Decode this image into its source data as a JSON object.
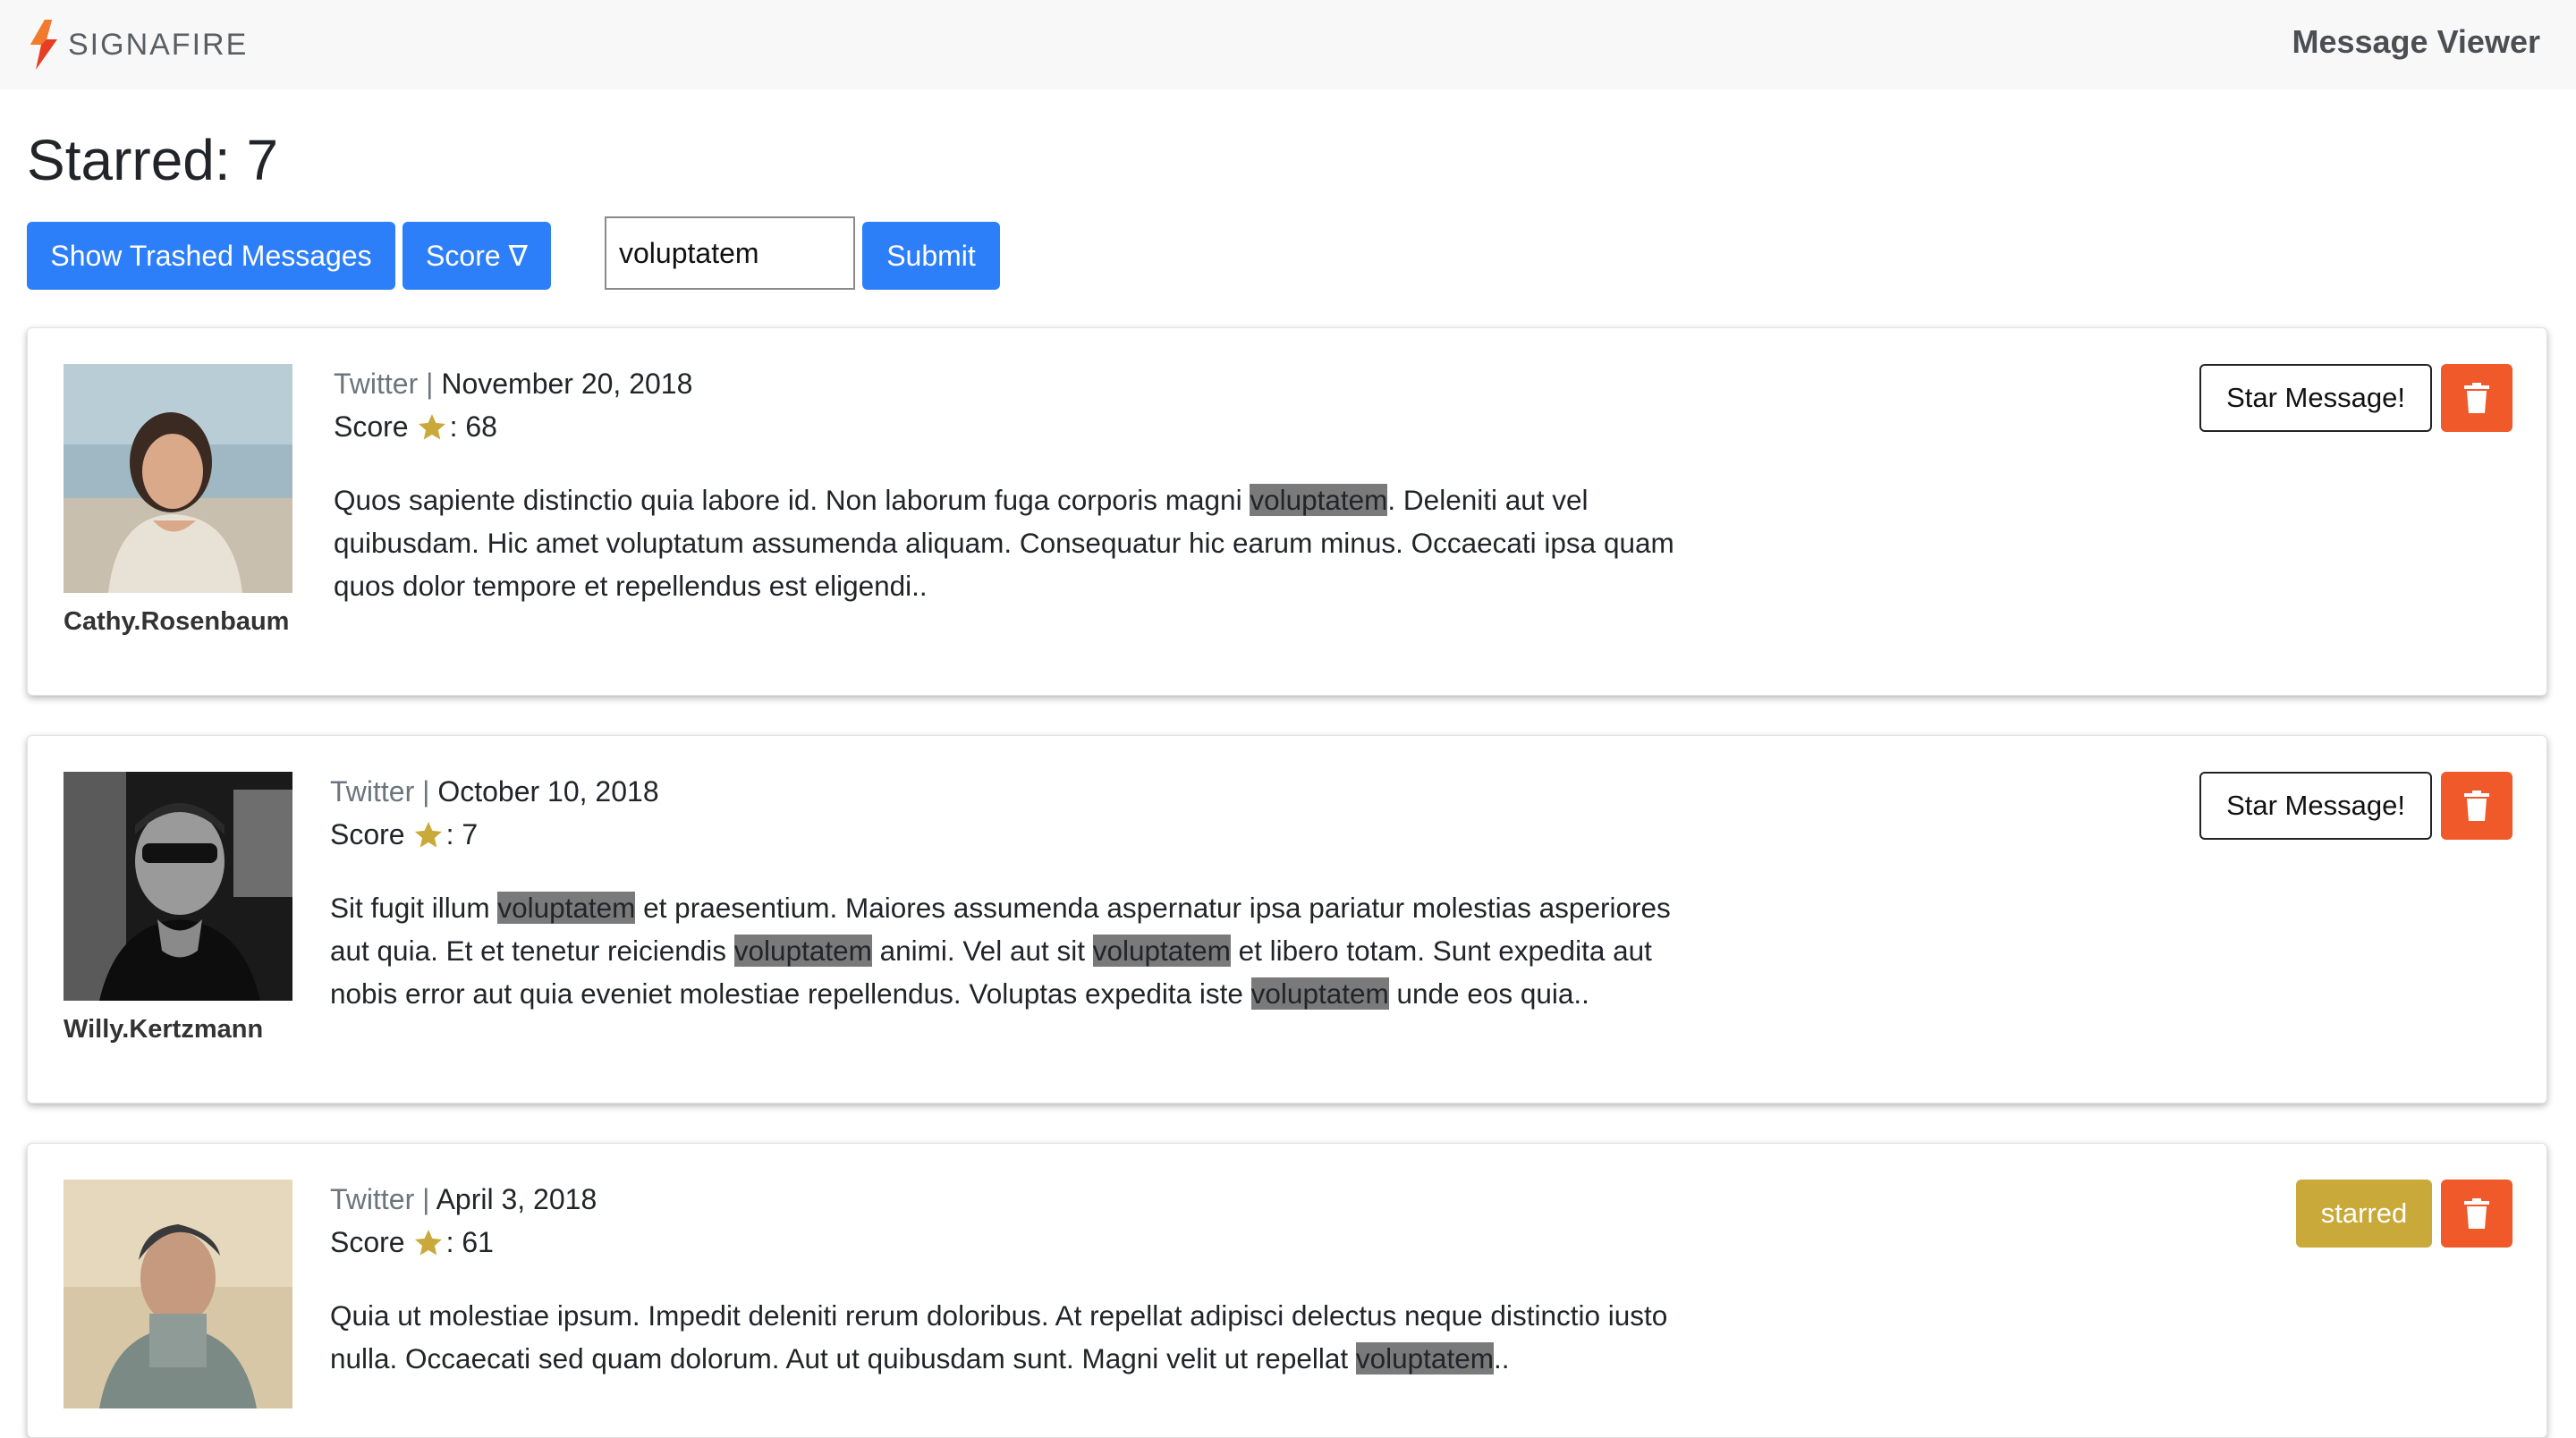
{
  "navbar": {
    "brand": "SIGNAFIRE",
    "title": "Message Viewer",
    "logo_colors": [
      "#e63e23",
      "#f27a2c"
    ]
  },
  "starred": {
    "label": "Starred: 7",
    "count": 7
  },
  "toolbar": {
    "show_trashed_label": "Show Trashed Messages",
    "score_sort_label": "Score ∇",
    "search_value": "voluptatem",
    "submit_label": "Submit"
  },
  "colors": {
    "primary": "#2d7ff9",
    "danger": "#f05a2a",
    "starred": "#c9a93a",
    "highlight": "#7a7a7a"
  },
  "messages": [
    {
      "username": "Cathy.Rosenbaum",
      "platform": "Twitter",
      "separator": "|",
      "date": "November 20, 2018",
      "score_label": "Score",
      "score_suffix": ": 68",
      "score": 68,
      "action_label": "Star Message!",
      "starred": false,
      "text_parts": [
        "Quos sapiente distinctio quia labore id. Non laborum fuga corporis magni ",
        "voluptatem",
        ". Deleniti aut vel quibusdam. Hic amet voluptatum assumenda aliquam. Consequatur hic earum minus. Occaecati ipsa quam quos dolor tempore et repellendus est eligendi.."
      ]
    },
    {
      "username": "Willy.Kertzmann",
      "platform": "Twitter",
      "separator": "|",
      "date": "October 10, 2018",
      "score_label": "Score",
      "score_suffix": ": 7",
      "score": 7,
      "action_label": "Star Message!",
      "starred": false,
      "text_parts": [
        "Sit fugit illum ",
        "voluptatem",
        " et praesentium. Maiores assumenda aspernatur ipsa pariatur molestias asperiores aut quia. Et et tenetur reiciendis ",
        "voluptatem",
        " animi. Vel aut sit ",
        "voluptatem",
        " et libero totam. Sunt expedita aut nobis error aut quia eveniet molestiae repellendus. Voluptas expedita iste ",
        "voluptatem",
        " unde eos quia.."
      ]
    },
    {
      "username": "",
      "platform": "Twitter",
      "separator": "|",
      "date": "April 3, 2018",
      "score_label": "Score",
      "score_suffix": ": 61",
      "score": 61,
      "action_label": "starred",
      "starred": true,
      "text_parts": [
        "Quia ut molestiae ipsum. Impedit deleniti rerum doloribus. At repellat adipisci delectus neque distinctio iusto nulla. Occaecati sed quam dolorum. Aut ut quibusdam sunt. Magni velit ut repellat ",
        "voluptatem",
        ".."
      ]
    }
  ]
}
